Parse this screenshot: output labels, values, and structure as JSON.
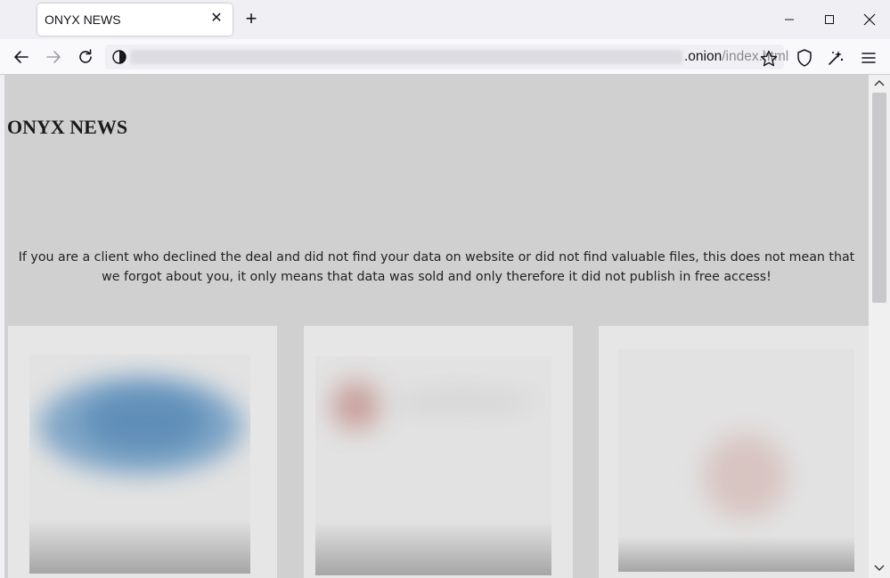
{
  "browser": {
    "tab": {
      "title": "ONYX NEWS",
      "close_icon": "close-icon"
    },
    "new_tab_label": "+",
    "address_bar": {
      "url_visible_suffix": ".onion",
      "url_path": "/index.html"
    },
    "icons": [
      "back-arrow-icon",
      "forward-arrow-icon",
      "reload-icon",
      "tor-identity-icon",
      "star-bookmark-icon",
      "shield-icon",
      "extensions-icon",
      "menu-icon",
      "minimize-icon",
      "maximize-icon",
      "window-close-icon"
    ]
  },
  "page": {
    "site_title": "ONYX NEWS",
    "notice": "If you are a client who declined the deal and did not find your data on website or did not find valuable files, this does not mean that we forgot about you, it only means that data was sold and only therefore it did not publish in free access!",
    "colors": {
      "background": "#d0d0d0",
      "card_background": "#e6e6e6"
    },
    "cards": [
      {
        "image": "blurred-preview-1"
      },
      {
        "image": "blurred-preview-2"
      },
      {
        "image": "blurred-preview-3"
      }
    ]
  }
}
